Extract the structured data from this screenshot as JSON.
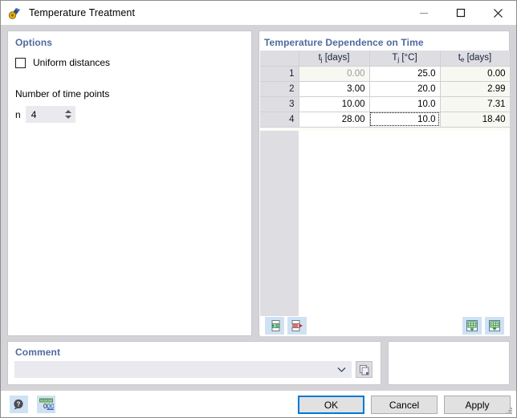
{
  "window": {
    "title": "Temperature Treatment",
    "icon": "temperature-treatment-icon",
    "minimize_label": "Minimize",
    "maximize_label": "Maximize",
    "close_label": "Close"
  },
  "options": {
    "title": "Options",
    "uniform_distances": {
      "label": "Uniform distances",
      "checked": false
    },
    "number_of_time_points": {
      "label": "Number of time points",
      "field_prefix": "n",
      "value": "4"
    }
  },
  "table": {
    "title": "Temperature Dependence on Time",
    "columns": [
      {
        "key": "index",
        "label": ""
      },
      {
        "key": "tj",
        "label": "t",
        "sub": "j",
        "unit": " [days]"
      },
      {
        "key": "Tj",
        "label": "T",
        "sub": "j",
        "unit": " [°C]"
      },
      {
        "key": "te",
        "label": "t",
        "sub": "e",
        "unit": " [days]"
      }
    ],
    "rows": [
      {
        "index": "1",
        "tj": "0.00",
        "Tj": "25.0",
        "te": "0.00"
      },
      {
        "index": "2",
        "tj": "3.00",
        "Tj": "20.0",
        "te": "2.99"
      },
      {
        "index": "3",
        "tj": "10.00",
        "Tj": "10.0",
        "te": "7.31"
      },
      {
        "index": "4",
        "tj": "28.00",
        "Tj": "10.0",
        "te": "18.40"
      }
    ],
    "toolbar": {
      "insert_row_label": "Insert row",
      "delete_row_label": "Delete row",
      "import_excel_label": "Import from Excel",
      "export_excel_label": "Export to Excel"
    }
  },
  "comment": {
    "title": "Comment",
    "value": "",
    "placeholder": "",
    "copy_button_label": "Copy"
  },
  "footer": {
    "help_label": "Help",
    "decimals_label": "0,00",
    "buttons": [
      {
        "label": "OK",
        "primary": true
      },
      {
        "label": "Cancel",
        "primary": false
      },
      {
        "label": "Apply",
        "primary": false
      }
    ]
  },
  "colors": {
    "accent": "#4f6a9e",
    "focus": "#0078d7",
    "header_bg": "#dedee2",
    "readonly_bg": "#f8f8f2",
    "icon_bg": "#cfe2f3"
  }
}
